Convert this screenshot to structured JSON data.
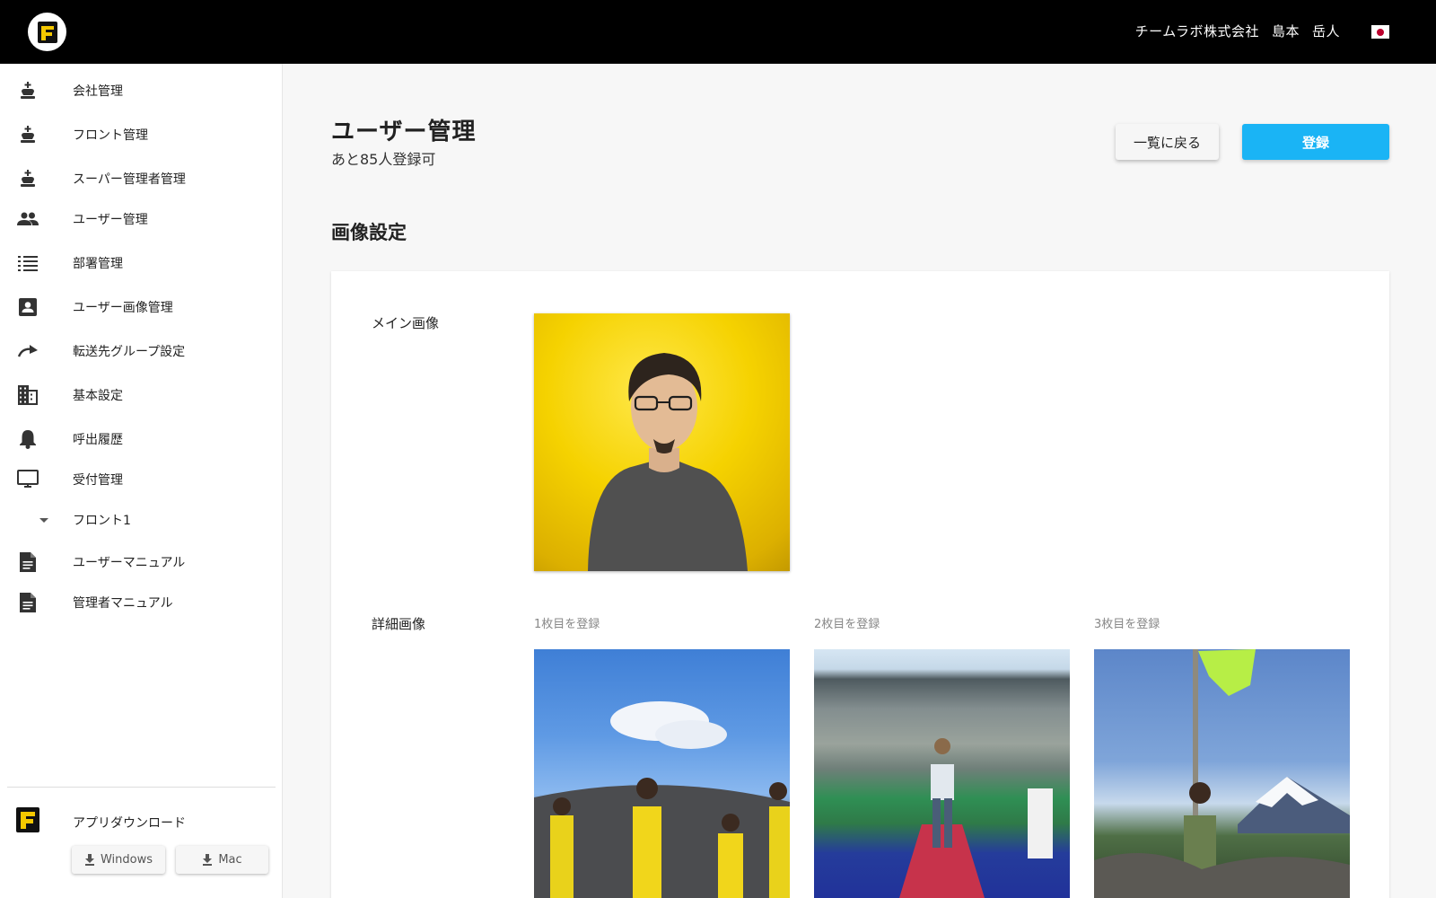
{
  "header": {
    "company": "チームラボ株式会社",
    "last_name": "島本",
    "first_name": "岳人",
    "flag_icon": "japan-flag-icon"
  },
  "sidebar": {
    "items": [
      {
        "label": "会社管理",
        "icon": "chess-king-icon"
      },
      {
        "label": "フロント管理",
        "icon": "chess-king-icon"
      },
      {
        "label": "スーパー管理者管理",
        "icon": "chess-king-icon"
      },
      {
        "label": "ユーザー管理",
        "icon": "people-icon"
      },
      {
        "label": "部署管理",
        "icon": "list-icon"
      },
      {
        "label": "ユーザー画像管理",
        "icon": "contact-card-icon"
      },
      {
        "label": "転送先グループ設定",
        "icon": "redo-arrow-icon"
      },
      {
        "label": "基本設定",
        "icon": "building-icon"
      },
      {
        "label": "呼出履歴",
        "icon": "bell-icon"
      },
      {
        "label": "受付管理",
        "icon": "monitor-icon"
      },
      {
        "label": "フロント1",
        "icon": "caret-down-icon"
      },
      {
        "label": "ユーザーマニュアル",
        "icon": "document-icon"
      },
      {
        "label": "管理者マニュアル",
        "icon": "document-icon"
      }
    ],
    "download": {
      "label": "アプリダウンロード",
      "windows": "Windows",
      "mac": "Mac"
    }
  },
  "main": {
    "title": "ユーザー管理",
    "subtitle": "あと85人登録可",
    "back_button": "一覧に戻る",
    "register_button": "登録",
    "section_title": "画像設定",
    "main_image_label": "メイン画像",
    "detail_image_label": "詳細画像",
    "slots": [
      "1枚目を登録",
      "2枚目を登録",
      "3枚目を登録"
    ]
  },
  "colors": {
    "accent": "#1ab4f5",
    "topbar": "#000000",
    "brand_yellow": "#f5c800"
  }
}
